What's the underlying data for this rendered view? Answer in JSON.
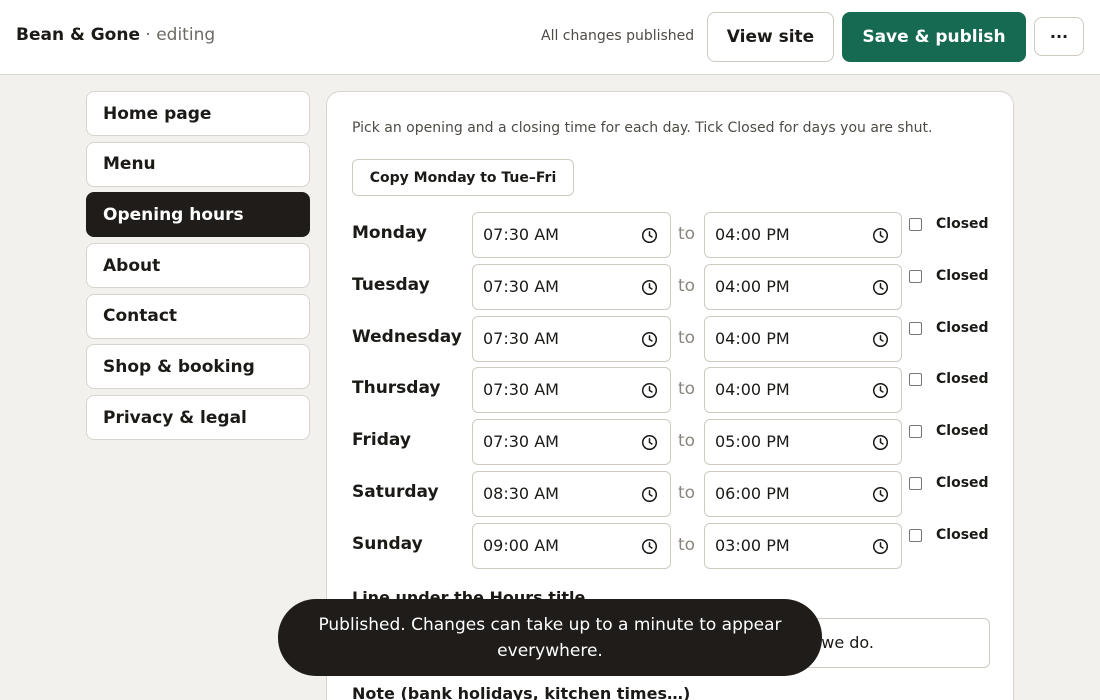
{
  "header": {
    "brand": "Bean & Gone",
    "state": "· editing",
    "status": "All changes published",
    "view_site": "View site",
    "save_publish": "Save & publish",
    "more": "···"
  },
  "sidebar": {
    "items": [
      {
        "label": "Home page",
        "active": false
      },
      {
        "label": "Menu",
        "active": false
      },
      {
        "label": "Opening hours",
        "active": true
      },
      {
        "label": "About",
        "active": false
      },
      {
        "label": "Contact",
        "active": false
      },
      {
        "label": "Shop & booking",
        "active": false
      },
      {
        "label": "Privacy & legal",
        "active": false
      }
    ]
  },
  "hours": {
    "hint": "Pick an opening and a closing time for each day. Tick Closed for days you are shut.",
    "copy_button": "Copy Monday to Tue–Fri",
    "separator": "to",
    "closed_label": "Closed",
    "days": [
      {
        "day": "Monday",
        "open": "07:30 AM",
        "close": "04:00 PM",
        "closed": false
      },
      {
        "day": "Tuesday",
        "open": "07:30 AM",
        "close": "04:00 PM",
        "closed": false
      },
      {
        "day": "Wednesday",
        "open": "07:30 AM",
        "close": "04:00 PM",
        "closed": false
      },
      {
        "day": "Thursday",
        "open": "07:30 AM",
        "close": "04:00 PM",
        "closed": false
      },
      {
        "day": "Friday",
        "open": "07:30 AM",
        "close": "05:00 PM",
        "closed": false
      },
      {
        "day": "Saturday",
        "open": "08:30 AM",
        "close": "06:00 PM",
        "closed": false
      },
      {
        "day": "Sunday",
        "open": "09:00 AM",
        "close": "03:00 PM",
        "closed": false
      }
    ],
    "subtitle_label": "Line under the Hours title",
    "subtitle_value_visible": "we do.",
    "note_label": "Note (bank holidays, kitchen times…)"
  },
  "toast": {
    "message": "Published. Changes can take up to a minute to appear everywhere."
  },
  "colors": {
    "accent": "#176a52",
    "dark": "#1f1c19",
    "background": "#f3f1ed"
  }
}
